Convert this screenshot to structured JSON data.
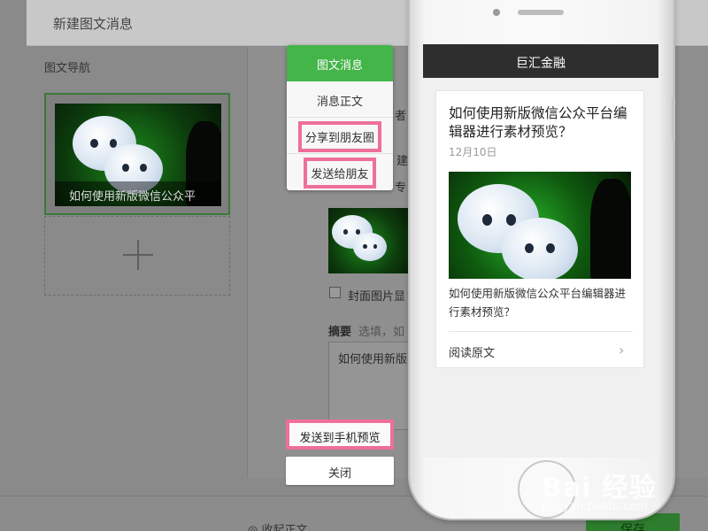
{
  "editor": {
    "header_title": "新建图文消息",
    "nav_title": "图文导航",
    "card_caption": "如何使用新版微信公众平",
    "field_fragments": [
      "者",
      "建",
      "专"
    ],
    "cover_checkbox_label": "封面图片显",
    "summary_label": "摘要",
    "summary_hint": "选填，如",
    "summary_value": "如何使用新版",
    "collapse_label": "收起正文",
    "save_label": "保存"
  },
  "menu": {
    "items": [
      {
        "label": "图文消息",
        "active": true
      },
      {
        "label": "消息正文",
        "active": false
      },
      {
        "label": "分享到朋友圈",
        "active": false
      },
      {
        "label": "发送给朋友",
        "active": false
      }
    ]
  },
  "actions": {
    "send_to_phone": "发送到手机预览",
    "close": "关闭"
  },
  "phone": {
    "account_name": "巨汇金融",
    "article": {
      "title": "如何使用新版微信公众平台编辑器进行素材预览？",
      "date": "12月10日",
      "summary": "如何使用新版微信公众平台编辑器进行素材预览？",
      "read_more": "阅读原文"
    }
  },
  "watermark": {
    "logo": "Bai 经验",
    "url": "jingyan.baidu.com"
  },
  "colors": {
    "accent_green": "#44b549",
    "highlight_pink": "#ee6f9b",
    "phone_title_bar": "#2e2e2e"
  }
}
